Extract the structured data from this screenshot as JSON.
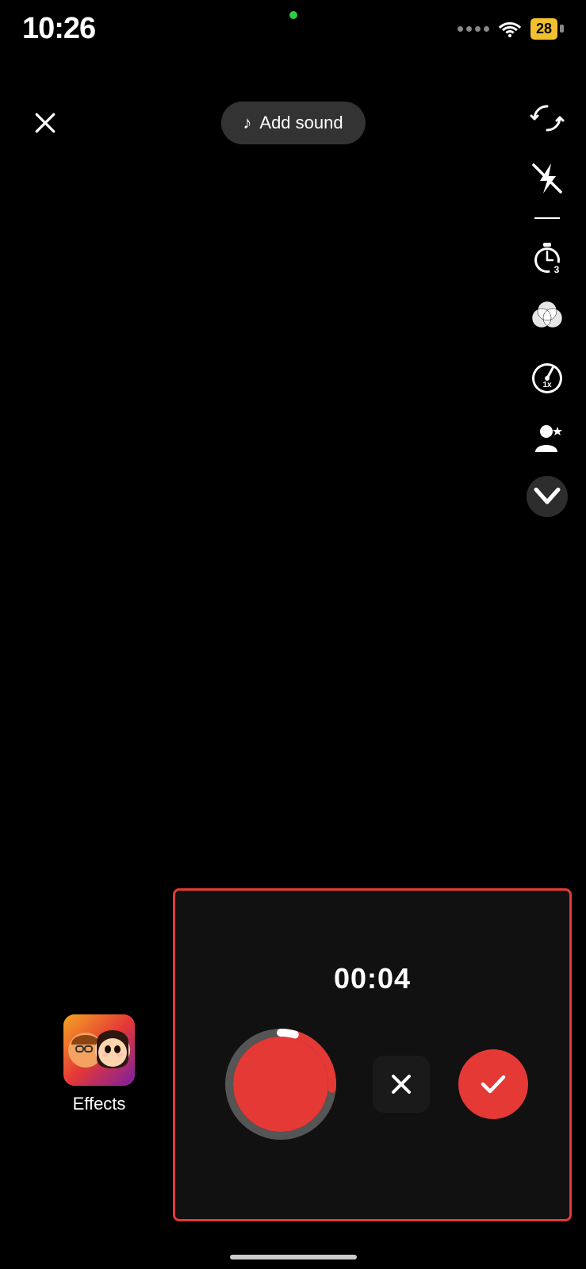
{
  "statusBar": {
    "time": "10:26",
    "battery": "28"
  },
  "header": {
    "addSoundLabel": "Add sound"
  },
  "toolbar": {
    "items": [
      {
        "name": "flip-icon",
        "label": "Flip"
      },
      {
        "name": "flash-icon",
        "label": "Flash"
      },
      {
        "name": "timer-icon",
        "label": "Timer"
      },
      {
        "name": "filters-icon",
        "label": "Filters"
      },
      {
        "name": "speed-icon",
        "label": "Speed"
      },
      {
        "name": "ai-effect-icon",
        "label": "AI Effect"
      },
      {
        "name": "more-icon",
        "label": "More"
      }
    ]
  },
  "recording": {
    "timer": "00:04",
    "deleteLabel": "×",
    "confirmLabel": "✓"
  },
  "effects": {
    "label": "Effects"
  }
}
